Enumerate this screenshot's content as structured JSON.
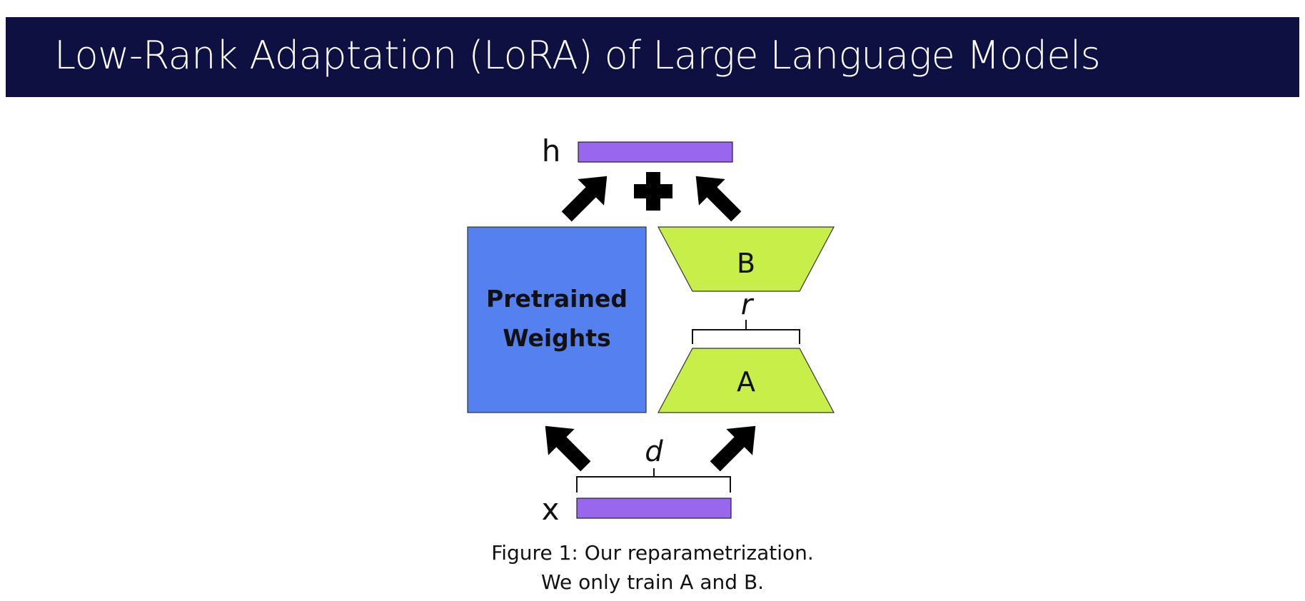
{
  "header": {
    "title": "Low-Rank Adaptation (LoRA) of Large Language Models"
  },
  "diagram": {
    "labels": {
      "output": "h",
      "input": "x",
      "pretrained_line1": "Pretrained",
      "pretrained_line2": "Weights",
      "matrix_b": "B",
      "matrix_a": "A",
      "rank": "r",
      "dimension": "d"
    },
    "icons": {
      "plus": "plus-icon",
      "arrow": "arrow-icon"
    },
    "colors": {
      "header_background": "#0e1042",
      "vector": "#9966ee",
      "pretrained": "#5580f0",
      "lora": "#c8ee4a",
      "arrow": "#000000"
    }
  },
  "caption": {
    "line1": "Figure 1: Our reparametrization.",
    "line2": "We only train A and B."
  }
}
